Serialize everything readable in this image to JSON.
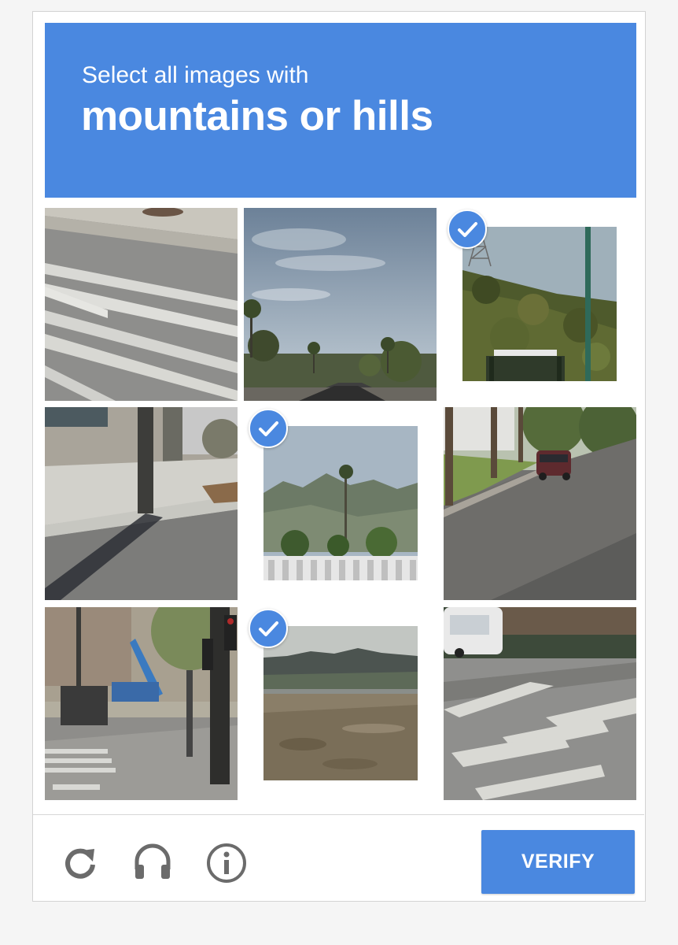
{
  "challenge": {
    "instruction": "Select all images with",
    "target": "mountains or hills"
  },
  "grid": {
    "tiles": [
      {
        "scene": "crosswalk-street",
        "selected": false
      },
      {
        "scene": "sky-with-palm-trees-street",
        "selected": false
      },
      {
        "scene": "hillside-with-tower",
        "selected": true
      },
      {
        "scene": "sidewalk-with-pole",
        "selected": false
      },
      {
        "scene": "mountains-with-palm-tree",
        "selected": true
      },
      {
        "scene": "residential-street-with-car",
        "selected": false
      },
      {
        "scene": "intersection-with-traffic-light",
        "selected": false
      },
      {
        "scene": "mountains-over-field",
        "selected": true
      },
      {
        "scene": "crosswalk-with-vehicle",
        "selected": false
      }
    ]
  },
  "footer": {
    "icons": [
      "reload-icon",
      "headphones-icon",
      "info-icon"
    ],
    "verify_label": "VERIFY"
  },
  "colors": {
    "accent": "#4a88e0",
    "icon_gray": "#6b6b6b"
  }
}
